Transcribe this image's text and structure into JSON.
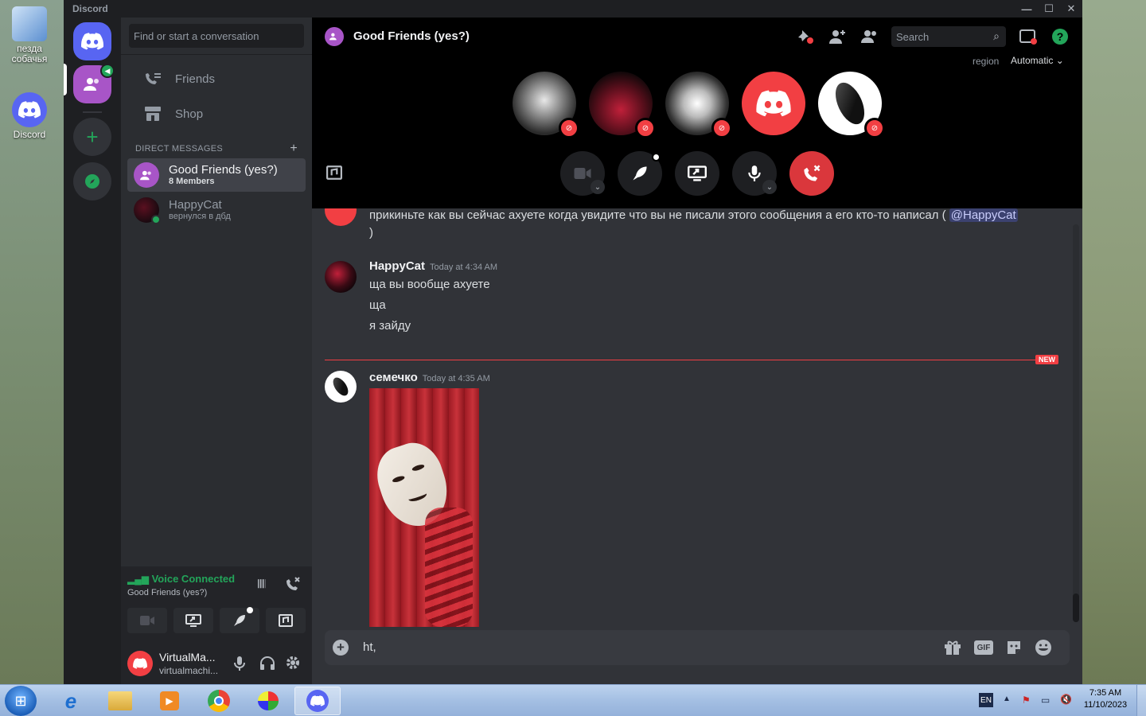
{
  "desktop": {
    "icons": [
      {
        "label": "пезда собачья"
      },
      {
        "label": "Discord"
      }
    ]
  },
  "window": {
    "title": "Discord",
    "controls": [
      "minimize-icon",
      "maximize-icon",
      "close-icon"
    ]
  },
  "guilds": {
    "items": [
      "home",
      "group-dm",
      "add-server",
      "explore"
    ]
  },
  "dm_sidebar": {
    "search_placeholder": "Find or start a conversation",
    "nav": [
      {
        "label": "Friends",
        "icon": "friends-icon"
      },
      {
        "label": "Shop",
        "icon": "shop-icon"
      }
    ],
    "section_title": "DIRECT MESSAGES",
    "dms": [
      {
        "name": "Good Friends (yes?)",
        "sub": "8 Members",
        "selected": true
      },
      {
        "name": "HappyCat",
        "sub": "вернулся в дбд",
        "status": "online"
      }
    ]
  },
  "voice_panel": {
    "title": "Voice Connected",
    "channel": "Good Friends (yes?)"
  },
  "user_panel": {
    "name": "VirtualMa...",
    "tag": "virtualmachi..."
  },
  "call": {
    "title": "Good Friends (yes?)",
    "search_placeholder": "Search",
    "region_label": "region",
    "region_value": "Automatic",
    "participants": 5
  },
  "messages": [
    {
      "text": "прикиньте как вы сейчас ахуете когда увидите что вы не писали этого сообщения а его кто-то написал (",
      "mention": "@HappyCat",
      "tail": ")"
    },
    {
      "author": "HappyCat",
      "time": "Today at 4:34 AM",
      "lines": [
        "ща вы вообще ахуете",
        "ща",
        "я зайду"
      ]
    },
    {
      "author": "семечко",
      "time": "Today at 4:35 AM",
      "attachment": "image"
    }
  ],
  "new_divider": "NEW",
  "composer": {
    "value": "ht,",
    "gif_label": "GIF"
  },
  "taskbar": {
    "lang": "EN",
    "time": "7:35 AM",
    "date": "11/10/2023"
  },
  "colors": {
    "blurple": "#5865f2",
    "green": "#23a55a",
    "red": "#f23f43",
    "group": "#a855c7"
  }
}
